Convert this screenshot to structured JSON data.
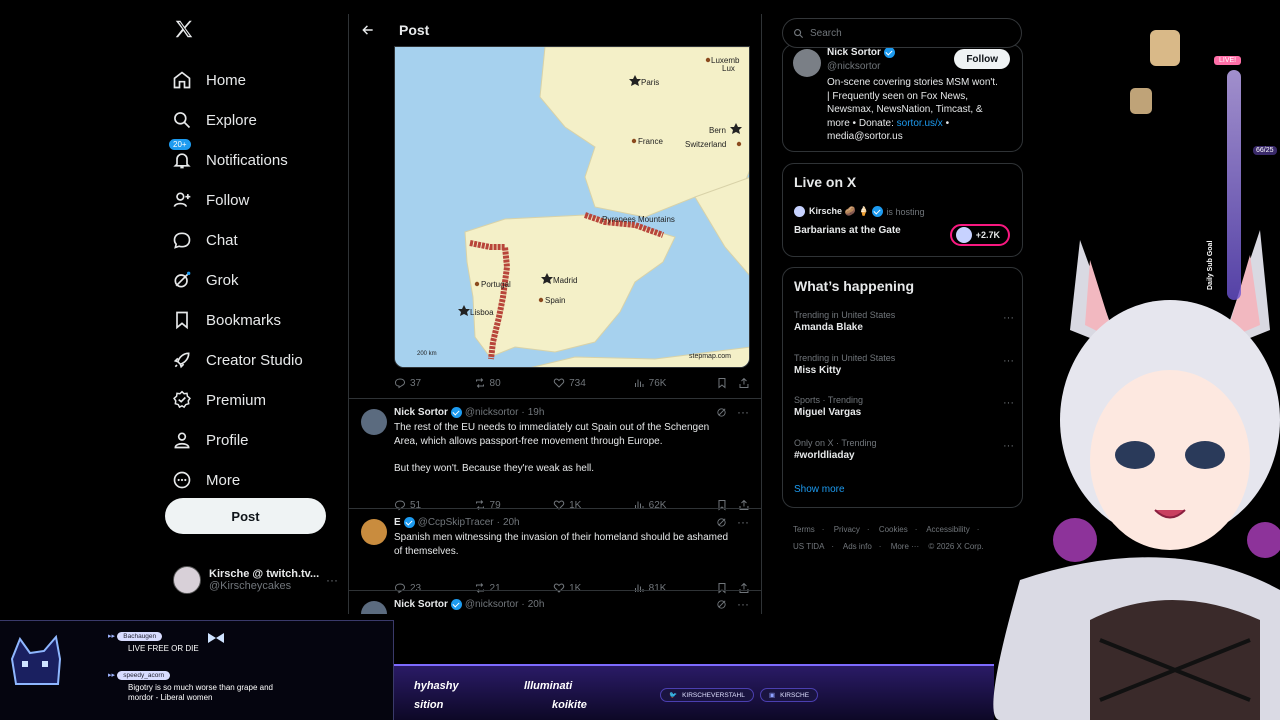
{
  "nav": {
    "items": [
      {
        "label": "Home",
        "icon": "home-icon"
      },
      {
        "label": "Explore",
        "icon": "search-icon"
      },
      {
        "label": "Notifications",
        "icon": "bell-icon",
        "badge": "20+"
      },
      {
        "label": "Follow",
        "icon": "person-add-icon"
      },
      {
        "label": "Chat",
        "icon": "chat-icon"
      },
      {
        "label": "Grok",
        "icon": "grok-icon"
      },
      {
        "label": "Bookmarks",
        "icon": "bookmark-icon"
      },
      {
        "label": "Creator Studio",
        "icon": "rocket-icon"
      },
      {
        "label": "Premium",
        "icon": "premium-icon"
      },
      {
        "label": "Profile",
        "icon": "person-icon"
      },
      {
        "label": "More",
        "icon": "more-circle-icon"
      }
    ],
    "post_button": "Post",
    "account": {
      "name": "Kirsche @ twitch.tv...",
      "handle": "@Kirscheycakes",
      "more": "···"
    }
  },
  "header": {
    "title": "Post"
  },
  "map": {
    "labels": {
      "paris": "Paris",
      "luxembourg": "Luxemb",
      "lux": "Lux",
      "france": "France",
      "bern": "Bern",
      "switzerland": "Switzerland",
      "pyrenees": "Pyrenees Mountains",
      "portugal": "Portugal",
      "madrid": "Madrid",
      "spain": "Spain",
      "lisboa": "Lisboa",
      "scale": "200 km",
      "credit": "stepmap.com"
    }
  },
  "main_post_stats": {
    "replies": "37",
    "reposts": "80",
    "likes": "734",
    "views": "76K"
  },
  "tweets": [
    {
      "name": "Nick Sortor",
      "handle": "@nicksortor",
      "time": "19h",
      "text_lines": [
        "The rest of the EU needs to immediately cut Spain out of the Schengen",
        "Area, which allows passport-free movement through Europe.",
        "",
        "But they won't. Because they're weak as hell."
      ],
      "stats": {
        "replies": "51",
        "reposts": "79",
        "likes": "1K",
        "views": "62K"
      }
    },
    {
      "name": "E",
      "handle": "@CcpSkipTracer",
      "time": "20h",
      "text_lines": [
        "Spanish men witnessing the invasion of their homeland should be ashamed",
        "of themselves."
      ],
      "stats": {
        "replies": "23",
        "reposts": "21",
        "likes": "1K",
        "views": "81K"
      }
    },
    {
      "name": "Nick Sortor",
      "handle": "@nicksortor",
      "time": "20h"
    }
  ],
  "search": {
    "placeholder": "Search"
  },
  "profile_card": {
    "name": "Nick Sortor",
    "handle": "@nicksortor",
    "follow": "Follow",
    "bio_lines": [
      "On-scene covering stories MSM won't.",
      "| Frequently seen on Fox News,",
      "Newsmax, NewsNation, Timcast, &",
      "more • Donate: "
    ],
    "bio_link": "sortor.us/x",
    "bio_end": " •",
    "bio_last": "media@sortor.us"
  },
  "live": {
    "title": "Live on X",
    "host_name": "Kirsche 🥔 🍦",
    "host_status": "is hosting",
    "space_title": "Barbarians at the Gate",
    "listeners": "+2.7K"
  },
  "trends": {
    "title": "What’s happening",
    "items": [
      {
        "meta": "Trending in United States",
        "topic": "Amanda Blake"
      },
      {
        "meta": "Trending in United States",
        "topic": "Miss Kitty"
      },
      {
        "meta": "Sports · Trending",
        "topic": "Miguel Vargas"
      },
      {
        "meta": "Only on X · Trending",
        "topic": "#worldliaday"
      }
    ],
    "show_more": "Show more"
  },
  "footer": {
    "links_row1": [
      "Terms",
      "Privacy",
      "Cookies",
      "Accessibility"
    ],
    "links_row2": [
      "US TIDA",
      "Ads info",
      "More ···"
    ],
    "copyright": "© 2026 X Corp."
  },
  "overlay": {
    "chat": [
      {
        "user": "Bachaugen",
        "text": "LIVE FREE OR DIE"
      },
      {
        "user": "speedy_acorn",
        "text_lines": [
          "Bigotry is so much worse than grape and",
          "mordor - Liberal women"
        ]
      }
    ],
    "ticker": [
      "hyhashy",
      "llluminati",
      "sition",
      "koikite"
    ],
    "socials": [
      "KIRSCHEVERSTAHL",
      "KIRSCHE"
    ],
    "sub_goal": "Daily Sub Goal",
    "live_tag": "LIVE!",
    "counter": "66/25"
  },
  "colors": {
    "accent": "#1d9bf0",
    "background": "#000000",
    "border": "#2f3336",
    "muted": "#71767b",
    "live": "#f91880"
  }
}
